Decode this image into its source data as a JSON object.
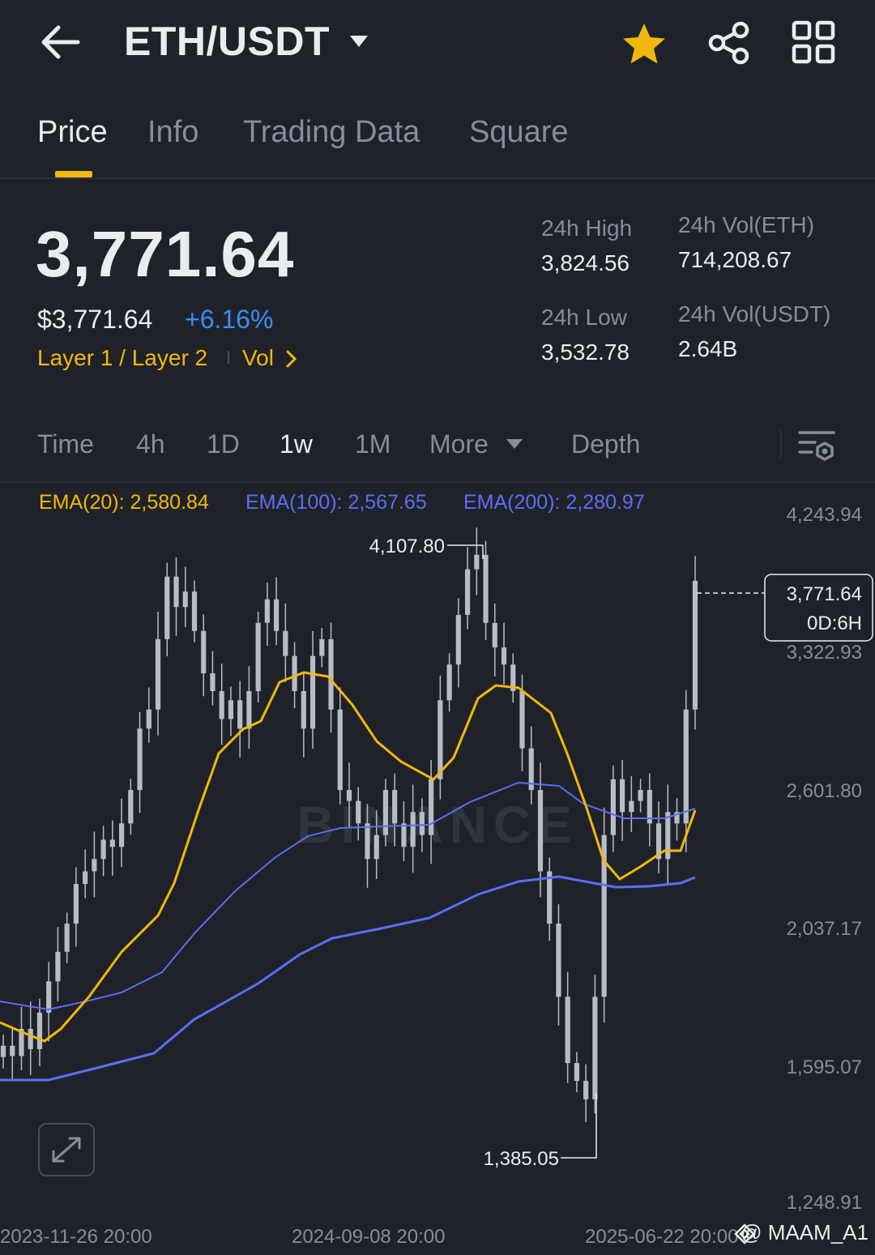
{
  "header": {
    "title": "ETH/USDT",
    "icons": [
      "back-arrow-icon",
      "caret-down-icon",
      "star-icon",
      "share-icon",
      "grid-icon"
    ],
    "favorite_color": "#F0B90B"
  },
  "tabs": [
    {
      "label": "Price",
      "active": true
    },
    {
      "label": "Info",
      "active": false
    },
    {
      "label": "Trading Data",
      "active": false
    },
    {
      "label": "Square",
      "active": false
    }
  ],
  "ticker": {
    "last_price": "3,771.64",
    "usd_price": "$3,771.64",
    "change_pct": "+6.16%",
    "tag_layer": "Layer 1 / Layer 2",
    "tag_vol": "Vol",
    "stats": {
      "high_label": "24h High",
      "high_value": "3,824.56",
      "low_label": "24h Low",
      "low_value": "3,532.78",
      "vol_eth_label": "24h Vol(ETH)",
      "vol_eth_value": "714,208.67",
      "vol_usdt_label": "24h Vol(USDT)",
      "vol_usdt_value": "2.64B"
    }
  },
  "timeframes": [
    {
      "label": "Time",
      "active": false
    },
    {
      "label": "4h",
      "active": false
    },
    {
      "label": "1D",
      "active": false
    },
    {
      "label": "1w",
      "active": true
    },
    {
      "label": "1M",
      "active": false
    },
    {
      "label": "More",
      "active": false
    },
    {
      "label": "Depth",
      "active": false
    }
  ],
  "indicators": {
    "ema20": "EMA(20): 2,580.84",
    "ema100": "EMA(100): 2,567.65",
    "ema200": "EMA(200): 2,280.97",
    "ema20_color": "#F0B90B",
    "ema100_color": "#5E6CF5",
    "ema200_color": "#5E6CF5"
  },
  "chart_data": {
    "type": "candlestick",
    "interval": "1w",
    "y_ticks": [
      "4,243.94",
      "3,322.93",
      "2,601.80",
      "2,037.17",
      "1,595.07",
      "1,248.91"
    ],
    "y_tick_values": [
      4243.94,
      3322.93,
      2601.8,
      2037.17,
      1595.07,
      1248.91
    ],
    "x_ticks": [
      "2023-11-26 20:00",
      "2024-09-08 20:00",
      "2025-06-22 20:00"
    ],
    "high_marker": {
      "label": "4,107.80",
      "value": 4107.8
    },
    "low_marker": {
      "label": "1,385.05",
      "value": 1385.05
    },
    "current_price_label": "3,771.64",
    "countdown_label": "0D:6H",
    "watermark": "BINANCE",
    "candle_color": "#B7BDC6",
    "approx_closes": [
      1650,
      1620,
      1700,
      1640,
      1750,
      1850,
      1950,
      2050,
      2200,
      2250,
      2300,
      2380,
      2350,
      2450,
      2600,
      2900,
      3000,
      3400,
      3800,
      3600,
      3700,
      3450,
      3200,
      3100,
      2950,
      3050,
      2900,
      3100,
      3500,
      3650,
      3450,
      3300,
      3100,
      2900,
      3300,
      3400,
      3000,
      2600,
      2550,
      2450,
      2300,
      2400,
      2600,
      2450,
      2350,
      2500,
      2400,
      2650,
      3050,
      3250,
      3550,
      3850,
      3950,
      3500,
      3350,
      3250,
      3100,
      2800,
      2600,
      2250,
      2050,
      1800,
      1600,
      1550,
      1500,
      1800,
      2400,
      2650,
      2500,
      2550,
      2600,
      2450,
      2300,
      2500,
      2450,
      3000,
      3771.64
    ]
  },
  "credit": "@ MAAM_A1"
}
